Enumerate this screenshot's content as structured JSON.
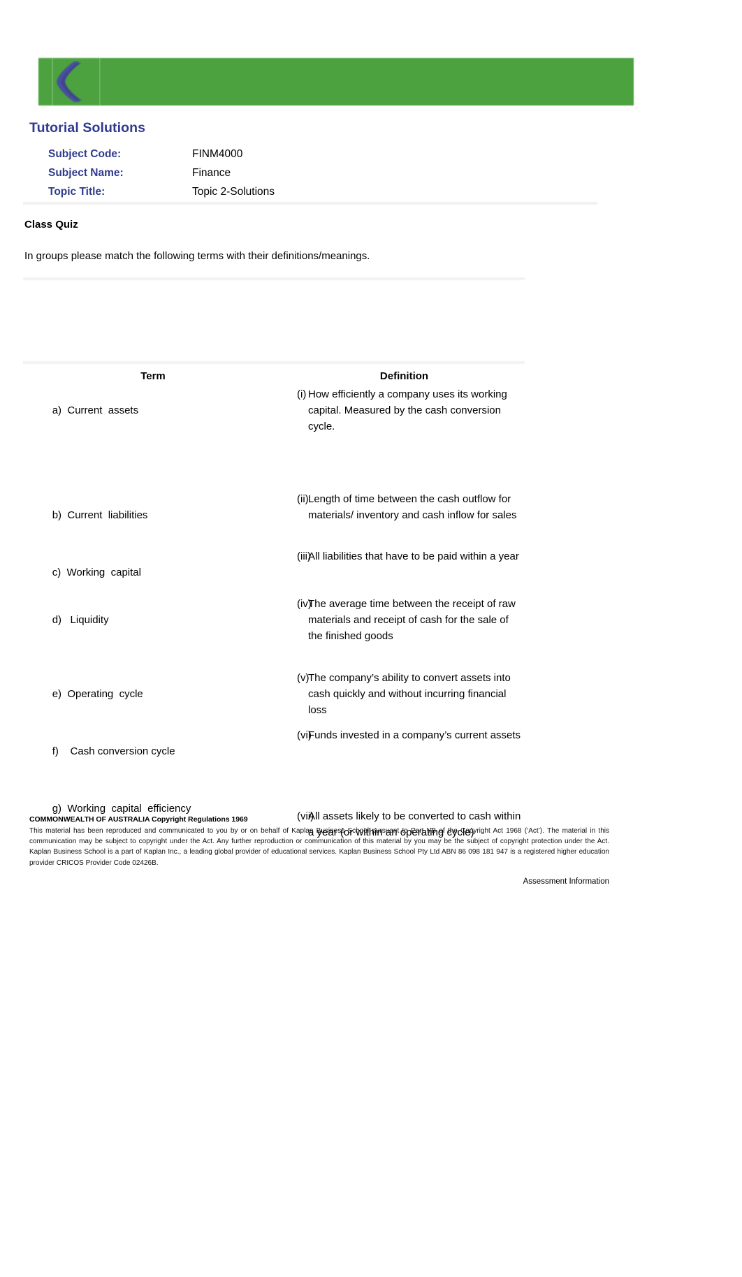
{
  "document": {
    "title": "Tutorial Solutions",
    "logo_alt": "Kaplan Business School logo",
    "meta": [
      {
        "label": "Subject Code:",
        "value": "FINM4000"
      },
      {
        "label": "Subject Name:",
        "value": "Finance"
      },
      {
        "label": "Topic Title:",
        "value": "Topic 2-Solutions"
      }
    ],
    "section_heading": "Class Quiz",
    "instruction": "In groups please match the following terms with their definitions/meanings."
  },
  "table": {
    "headers": {
      "term": "Term",
      "definition": "Definition"
    },
    "terms": [
      {
        "marker": "a)",
        "text": "Current  assets"
      },
      {
        "marker": "b)",
        "text": "Current  liabilities"
      },
      {
        "marker": "c)",
        "text": "Working  capital"
      },
      {
        "marker": "d)",
        "text": "Liquidity"
      },
      {
        "marker": "e)",
        "text": "Operating  cycle"
      },
      {
        "marker": "f)",
        "text": "Cash conversion cycle"
      },
      {
        "marker": "g)",
        "text": "Working  capital  efficiency"
      }
    ],
    "definitions": [
      {
        "marker": "(i)",
        "text": "How efficiently a company uses its working capital. Measured by the cash conversion cycle."
      },
      {
        "marker": "(ii)",
        "text": "Length of time between the cash outflow for materials/ inventory and cash inflow for sales"
      },
      {
        "marker": "(iii)",
        "text": "All liabilities that have to be paid within a year"
      },
      {
        "marker": "(iv)",
        "text": "The average time between the receipt of raw materials and receipt of cash for the sale of the finished goods"
      },
      {
        "marker": "(v)",
        "text": "The company’s ability to convert assets into cash quickly and without incurring financial loss"
      },
      {
        "marker": "(vi)",
        "text": "Funds invested in a company’s current assets"
      },
      {
        "marker": "(vii)",
        "text": "All assets likely to be converted to cash within a year (or within an operating cycle)"
      }
    ]
  },
  "footer": {
    "heading": "COMMONWEALTH OF AUSTRALIA Copyright Regulations 1969",
    "body": "This material has been reproduced and communicated to you by or on behalf of Kaplan Business School pursuant to Part VB of the Copyright Act 1968  (‘Act’). The material in this communication may be subject to copyright under the Act. Any further reproduction or communication of this material by you may be the subject of copyright protection under the Act. Kaplan Business School is a part of Kaplan Inc., a leading global provider of educational services. Kaplan Business School Pty Ltd ABN 86 098 181 947 is a registered higher education provider CRICOS Provider Code 02426B.",
    "page_label": "Assessment Information"
  },
  "colors": {
    "brand_green": "#4ba23f",
    "brand_blue": "#2f3b8f",
    "rule_grey": "#d9d9d9"
  }
}
